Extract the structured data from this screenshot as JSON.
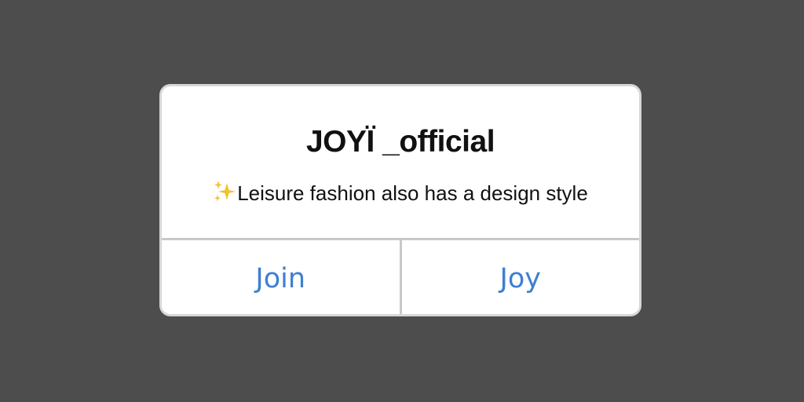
{
  "dialog": {
    "title": "JOYÏ _official",
    "subtitle_icon": "sparkles-icon",
    "subtitle": "Leisure fashion also has a design style",
    "buttons": {
      "left_label": "Join",
      "right_label": "Joy"
    }
  },
  "colors": {
    "backdrop": "#4d4d4d",
    "dialog_background": "#ffffff",
    "button_text": "#3f7fd0",
    "divider": "#c8c8c8",
    "sparkle": "#f2c230"
  }
}
